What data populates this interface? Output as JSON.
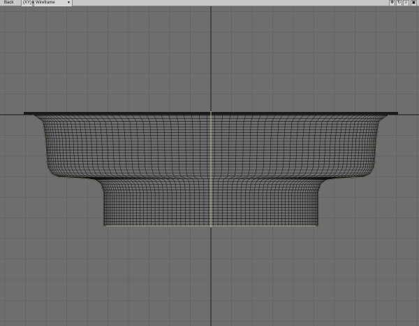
{
  "toolbar": {
    "view_name": "Back",
    "axis_label": "(XY)",
    "display_mode": "Wireframe",
    "icons": [
      "move-view-icon",
      "rotate-view-icon",
      "zoom-view-icon",
      "maximize-view-icon"
    ]
  },
  "viewport": {
    "background_color": "#6e6e6e",
    "grid_color": "#5f5f5f",
    "axis_color": "#1a1a1a",
    "mesh_color": "#0d0d0d",
    "highlight_color": "#e8e8c0"
  }
}
